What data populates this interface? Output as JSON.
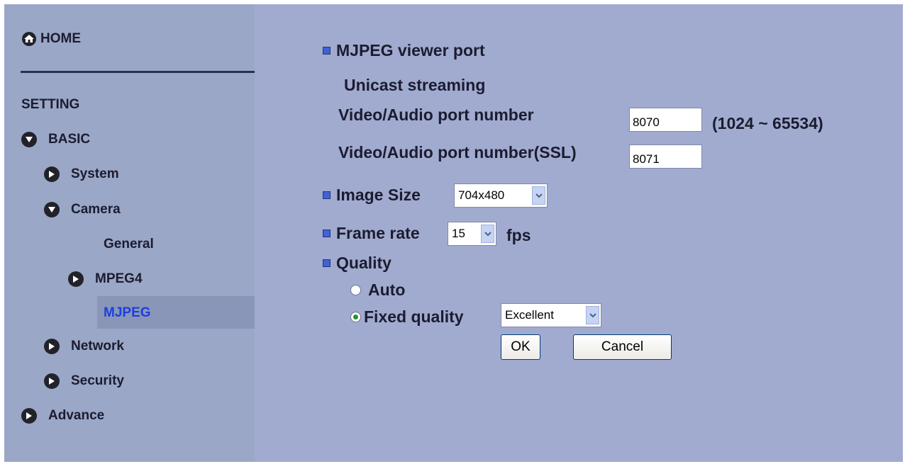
{
  "sidebar": {
    "home": "HOME",
    "setting": "SETTING",
    "items": [
      {
        "label": "BASIC",
        "state": "expanded"
      },
      {
        "label": "System",
        "state": "collapsed"
      },
      {
        "label": "Camera",
        "state": "expanded"
      },
      {
        "label": "General",
        "state": "none"
      },
      {
        "label": "MPEG4",
        "state": "collapsed"
      },
      {
        "label": "MJPEG",
        "state": "selected"
      },
      {
        "label": "Network",
        "state": "collapsed"
      },
      {
        "label": "Security",
        "state": "collapsed"
      },
      {
        "label": "Advance",
        "state": "collapsed"
      }
    ]
  },
  "main": {
    "viewer_port": {
      "title": "MJPEG viewer port",
      "unicast": "Unicast streaming",
      "port_label": "Video/Audio port number",
      "port_value": "8070",
      "port_range": "(1024 ~ 65534)",
      "ssl_label": "Video/Audio port number(SSL)",
      "ssl_value": "8071"
    },
    "image_size": {
      "label": "Image Size",
      "value": "704x480"
    },
    "frame_rate": {
      "label": "Frame rate",
      "value": "15",
      "unit": "fps"
    },
    "quality": {
      "label": "Quality",
      "auto": "Auto",
      "fixed": "Fixed quality",
      "fixed_value": "Excellent",
      "selected": "fixed"
    },
    "ok": "OK",
    "cancel": "Cancel"
  },
  "colors": {
    "sidebar_bg": "#9aa7c7",
    "main_bg": "#a1abd0",
    "selected_text": "#1d3fe0",
    "bullet": "#3e63d6"
  }
}
